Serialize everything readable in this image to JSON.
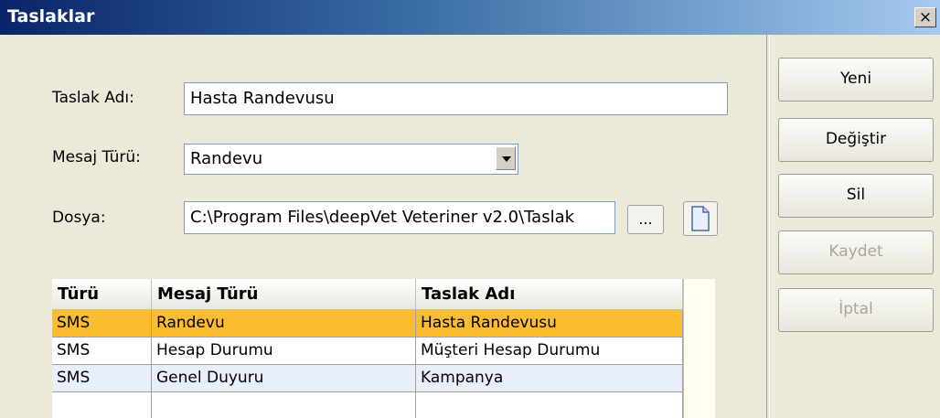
{
  "window": {
    "title": "Taslaklar",
    "close_glyph": "×"
  },
  "form": {
    "name_label": "Taslak Adı:",
    "name_value": "Hasta Randevusu",
    "type_label": "Mesaj Türü:",
    "type_value": "Randevu",
    "file_label": "Dosya:",
    "file_value": "C:\\Program Files\\deepVet Veteriner v2.0\\Taslak",
    "browse_label": "...",
    "new_file_icon": "document-icon"
  },
  "buttons": {
    "new": "Yeni",
    "edit": "Değiştir",
    "delete": "Sil",
    "save": "Kaydet",
    "cancel": "İptal"
  },
  "grid": {
    "columns": [
      "Türü",
      "Mesaj Türü",
      "Taslak Adı"
    ],
    "rows": [
      [
        "SMS",
        "Randevu",
        "Hasta Randevusu"
      ],
      [
        "SMS",
        "Hesap Durumu",
        "Müşteri Hesap Durumu"
      ],
      [
        "SMS",
        "Genel Duyuru",
        "Kampanya"
      ]
    ],
    "selected_row": 0,
    "selection_color": "#fbbd2f"
  }
}
